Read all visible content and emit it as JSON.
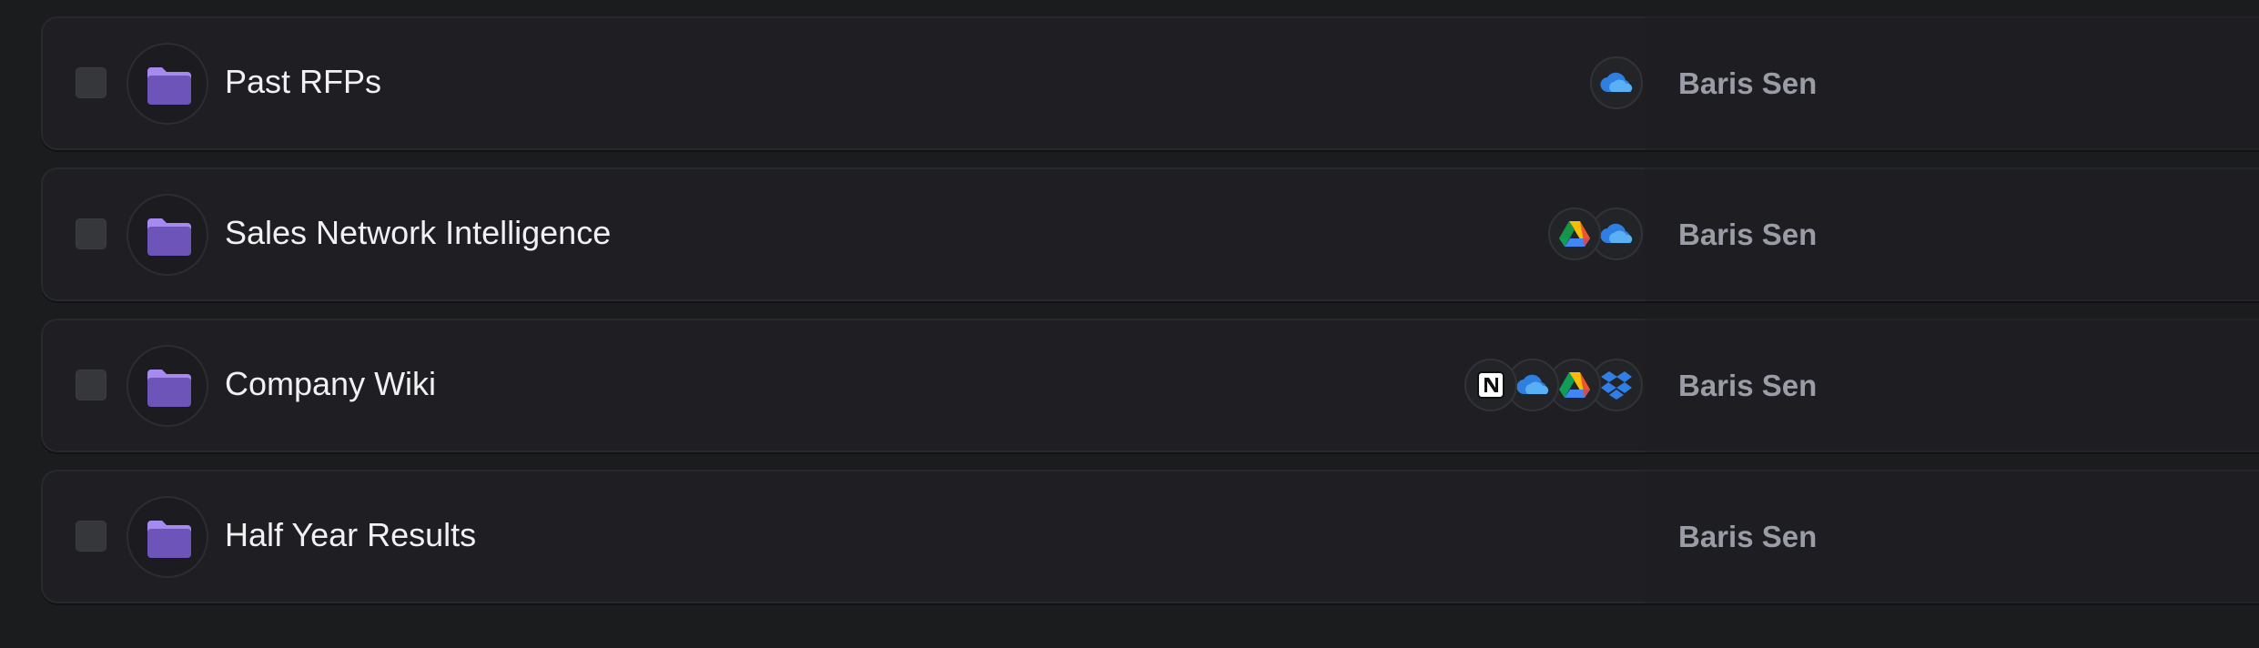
{
  "rows": [
    {
      "name": "Past RFPs",
      "sources": [
        "onedrive-icon"
      ],
      "owner": "Baris Sen"
    },
    {
      "name": "Sales Network Intelligence",
      "sources": [
        "onedrive-icon",
        "google-drive-icon"
      ],
      "owner": "Baris Sen"
    },
    {
      "name": "Company Wiki",
      "sources": [
        "dropbox-icon",
        "google-drive-icon",
        "onedrive-icon",
        "notion-icon"
      ],
      "owner": "Baris Sen"
    },
    {
      "name": "Half Year Results",
      "sources": [],
      "owner": "Baris Sen"
    }
  ],
  "colors": {
    "background": "#1b1c1e",
    "row": "#1f1f23",
    "folder": "#7b62c9",
    "title": "#f1f1f3",
    "owner": "#9a9ca6"
  }
}
